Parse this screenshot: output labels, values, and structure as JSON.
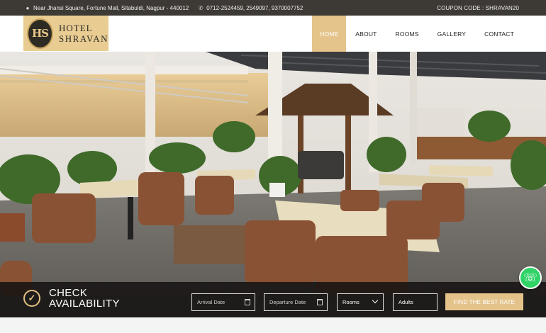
{
  "topbar": {
    "address": "Near Jhansi Square, Fortune Mall, Sitabuldi, Nagpur - 440012",
    "address_icon": "map-pin-icon",
    "phone": "0712-2524459, 2549097, 9370007752",
    "phone_icon": "phone-icon",
    "coupon": "COUPON CODE : SHRAVAN20"
  },
  "logo": {
    "mark": "HS",
    "line1": "HOTEL",
    "line2": "SHRAVAN",
    "brand_color": "#e8cc92"
  },
  "nav": {
    "items": [
      {
        "label": "HOME",
        "active": true
      },
      {
        "label": "ABOUT",
        "active": false
      },
      {
        "label": "ROOMS",
        "active": false
      },
      {
        "label": "GALLERY",
        "active": false
      },
      {
        "label": "CONTACT",
        "active": false
      }
    ],
    "active_color": "#e4c48a"
  },
  "booking": {
    "title_line1": "CHECK",
    "title_line2": "AVAILABILITY",
    "arrival_placeholder": "Arrival Date",
    "departure_placeholder": "Departure Date",
    "rooms_value": "Rooms",
    "adults_value": "Adults",
    "cta_label": "FIND THE BEST RATE",
    "accent": "#e4c38b"
  },
  "hero": {
    "image": "rooftop-restaurant-photo"
  },
  "whatsapp": {
    "icon": "whatsapp-icon",
    "color": "#2fd366"
  }
}
